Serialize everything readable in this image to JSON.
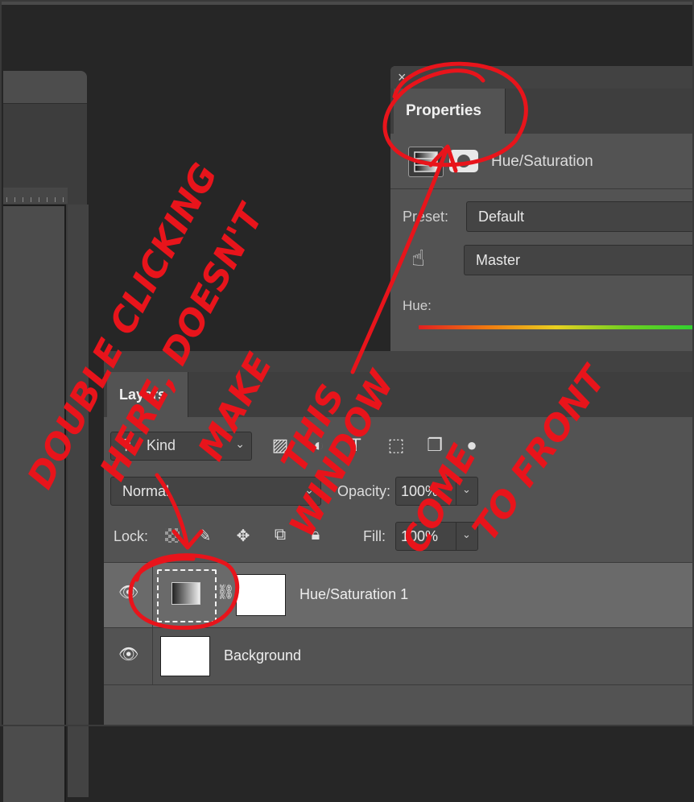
{
  "properties_panel": {
    "close_label": "×",
    "tab_label": "Properties",
    "adjustment_name": "Hue/Saturation",
    "preset_label": "Preset:",
    "preset_value": "Default",
    "channel_value": "Master",
    "hue_label": "Hue:"
  },
  "layers_panel": {
    "tab_label": "Layers",
    "filter_kind": "Kind",
    "blend_mode": "Normal",
    "opacity_label": "Opacity:",
    "opacity_value": "100%",
    "lock_label": "Lock:",
    "fill_label": "Fill:",
    "fill_value": "100%",
    "layers": [
      {
        "name": "Hue/Saturation 1"
      },
      {
        "name": "Background"
      }
    ]
  },
  "annotation": {
    "color": "#e8141b",
    "lines": [
      "DOUBLE CLICKING",
      "HERE, DOESN'T",
      "MAKE",
      "THIS",
      "WINDOW",
      "COME",
      "TO FRONT"
    ]
  }
}
